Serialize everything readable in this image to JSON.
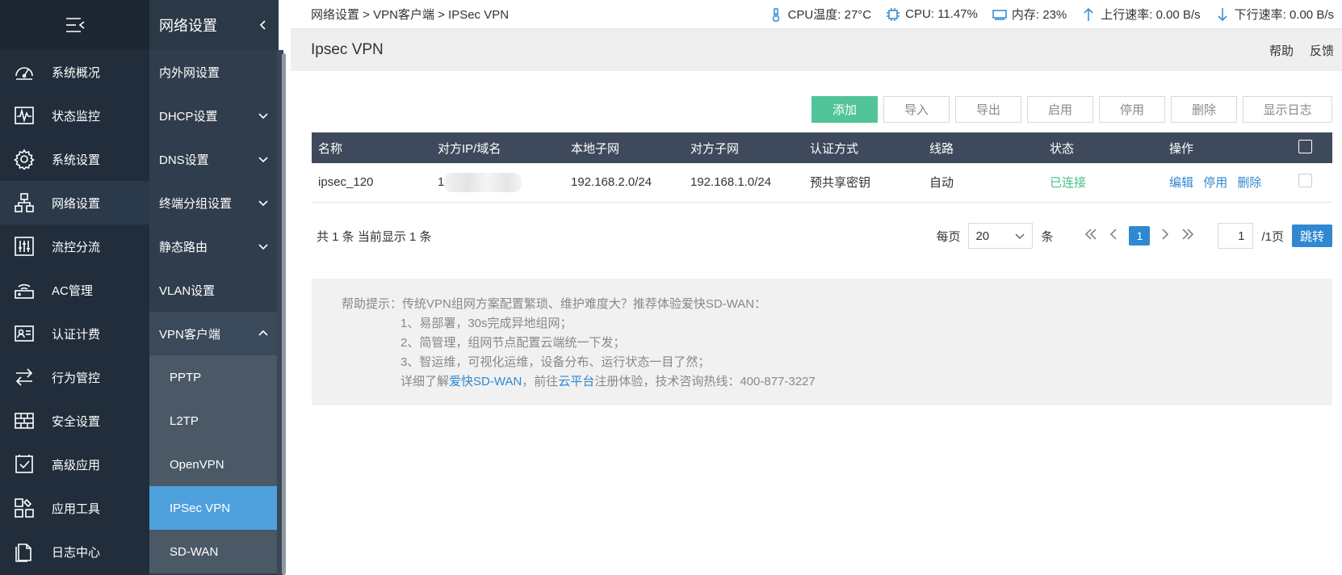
{
  "sidebar": {
    "items": [
      {
        "label": "系统概况",
        "icon": "dashboard-icon"
      },
      {
        "label": "状态监控",
        "icon": "monitor-icon"
      },
      {
        "label": "系统设置",
        "icon": "gear-icon"
      },
      {
        "label": "网络设置",
        "icon": "network-icon",
        "active": true
      },
      {
        "label": "流控分流",
        "icon": "sliders-icon"
      },
      {
        "label": "AC管理",
        "icon": "wifi-router-icon"
      },
      {
        "label": "认证计费",
        "icon": "id-card-icon"
      },
      {
        "label": "行为管控",
        "icon": "arrows-icon"
      },
      {
        "label": "安全设置",
        "icon": "firewall-icon"
      },
      {
        "label": "高级应用",
        "icon": "checklist-icon"
      },
      {
        "label": "应用工具",
        "icon": "tools-icon"
      },
      {
        "label": "日志中心",
        "icon": "document-icon"
      }
    ]
  },
  "subnav": {
    "title": "网络设置",
    "items": [
      {
        "label": "内外网设置"
      },
      {
        "label": "DHCP设置"
      },
      {
        "label": "DNS设置"
      },
      {
        "label": "终端分组设置"
      },
      {
        "label": "静态路由"
      },
      {
        "label": "VLAN设置"
      },
      {
        "label": "VPN客户端"
      }
    ],
    "subitems": [
      {
        "label": "PPTP"
      },
      {
        "label": "L2TP"
      },
      {
        "label": "OpenVPN"
      },
      {
        "label": "IPSec VPN"
      },
      {
        "label": "SD-WAN"
      }
    ]
  },
  "topbar": {
    "breadcrumb": "网络设置 > VPN客户端 > IPSec VPN",
    "cpu_temp": "CPU温度: 27°C",
    "cpu": "CPU: 11.47%",
    "memory": "内存: 23%",
    "upload": "上行速率: 0.00 B/s",
    "download": "下行速率: 0.00 B/s"
  },
  "page": {
    "title": "Ipsec VPN",
    "help_link": "帮助",
    "feedback_link": "反馈"
  },
  "toolbar": {
    "add": "添加",
    "import": "导入",
    "export": "导出",
    "enable": "启用",
    "disable": "停用",
    "delete": "删除",
    "show_log": "显示日志"
  },
  "table": {
    "headers": [
      "名称",
      "对方IP/域名",
      "本地子网",
      "对方子网",
      "认证方式",
      "线路",
      "状态",
      "操作"
    ],
    "rows": [
      {
        "name": "ipsec_120",
        "peer": "1",
        "local_subnet": "192.168.2.0/24",
        "peer_subnet": "192.168.1.0/24",
        "auth": "预共享密钥",
        "line": "自动",
        "status": "已连接",
        "edit": "编辑",
        "disable": "停用",
        "delete": "删除"
      }
    ]
  },
  "pager": {
    "summary": "共 1 条 当前显示 1 条",
    "per_page_label": "每页",
    "per_page_value": "20",
    "unit": "条",
    "current_page": "1",
    "goto_value": "1",
    "total_pages": "/1页",
    "goto_button": "跳转"
  },
  "help": {
    "lead": "帮助提示：传统VPN组网方案配置繁琐、维护难度大？推荐体验爱快SD-WAN：",
    "point1": "1、易部署，30s完成异地组网；",
    "point2": "2、简管理，组网节点配置云端统一下发；",
    "point3": "3、智运维，可视化运维，设备分布、运行状态一目了然；",
    "detail_prefix": "详细了解",
    "sdwan_link": "爱快SD-WAN",
    "detail_mid": "，前往",
    "cloud_link": "云平台",
    "detail_suffix": "注册体验，技术咨询热线：400-877-3227"
  }
}
